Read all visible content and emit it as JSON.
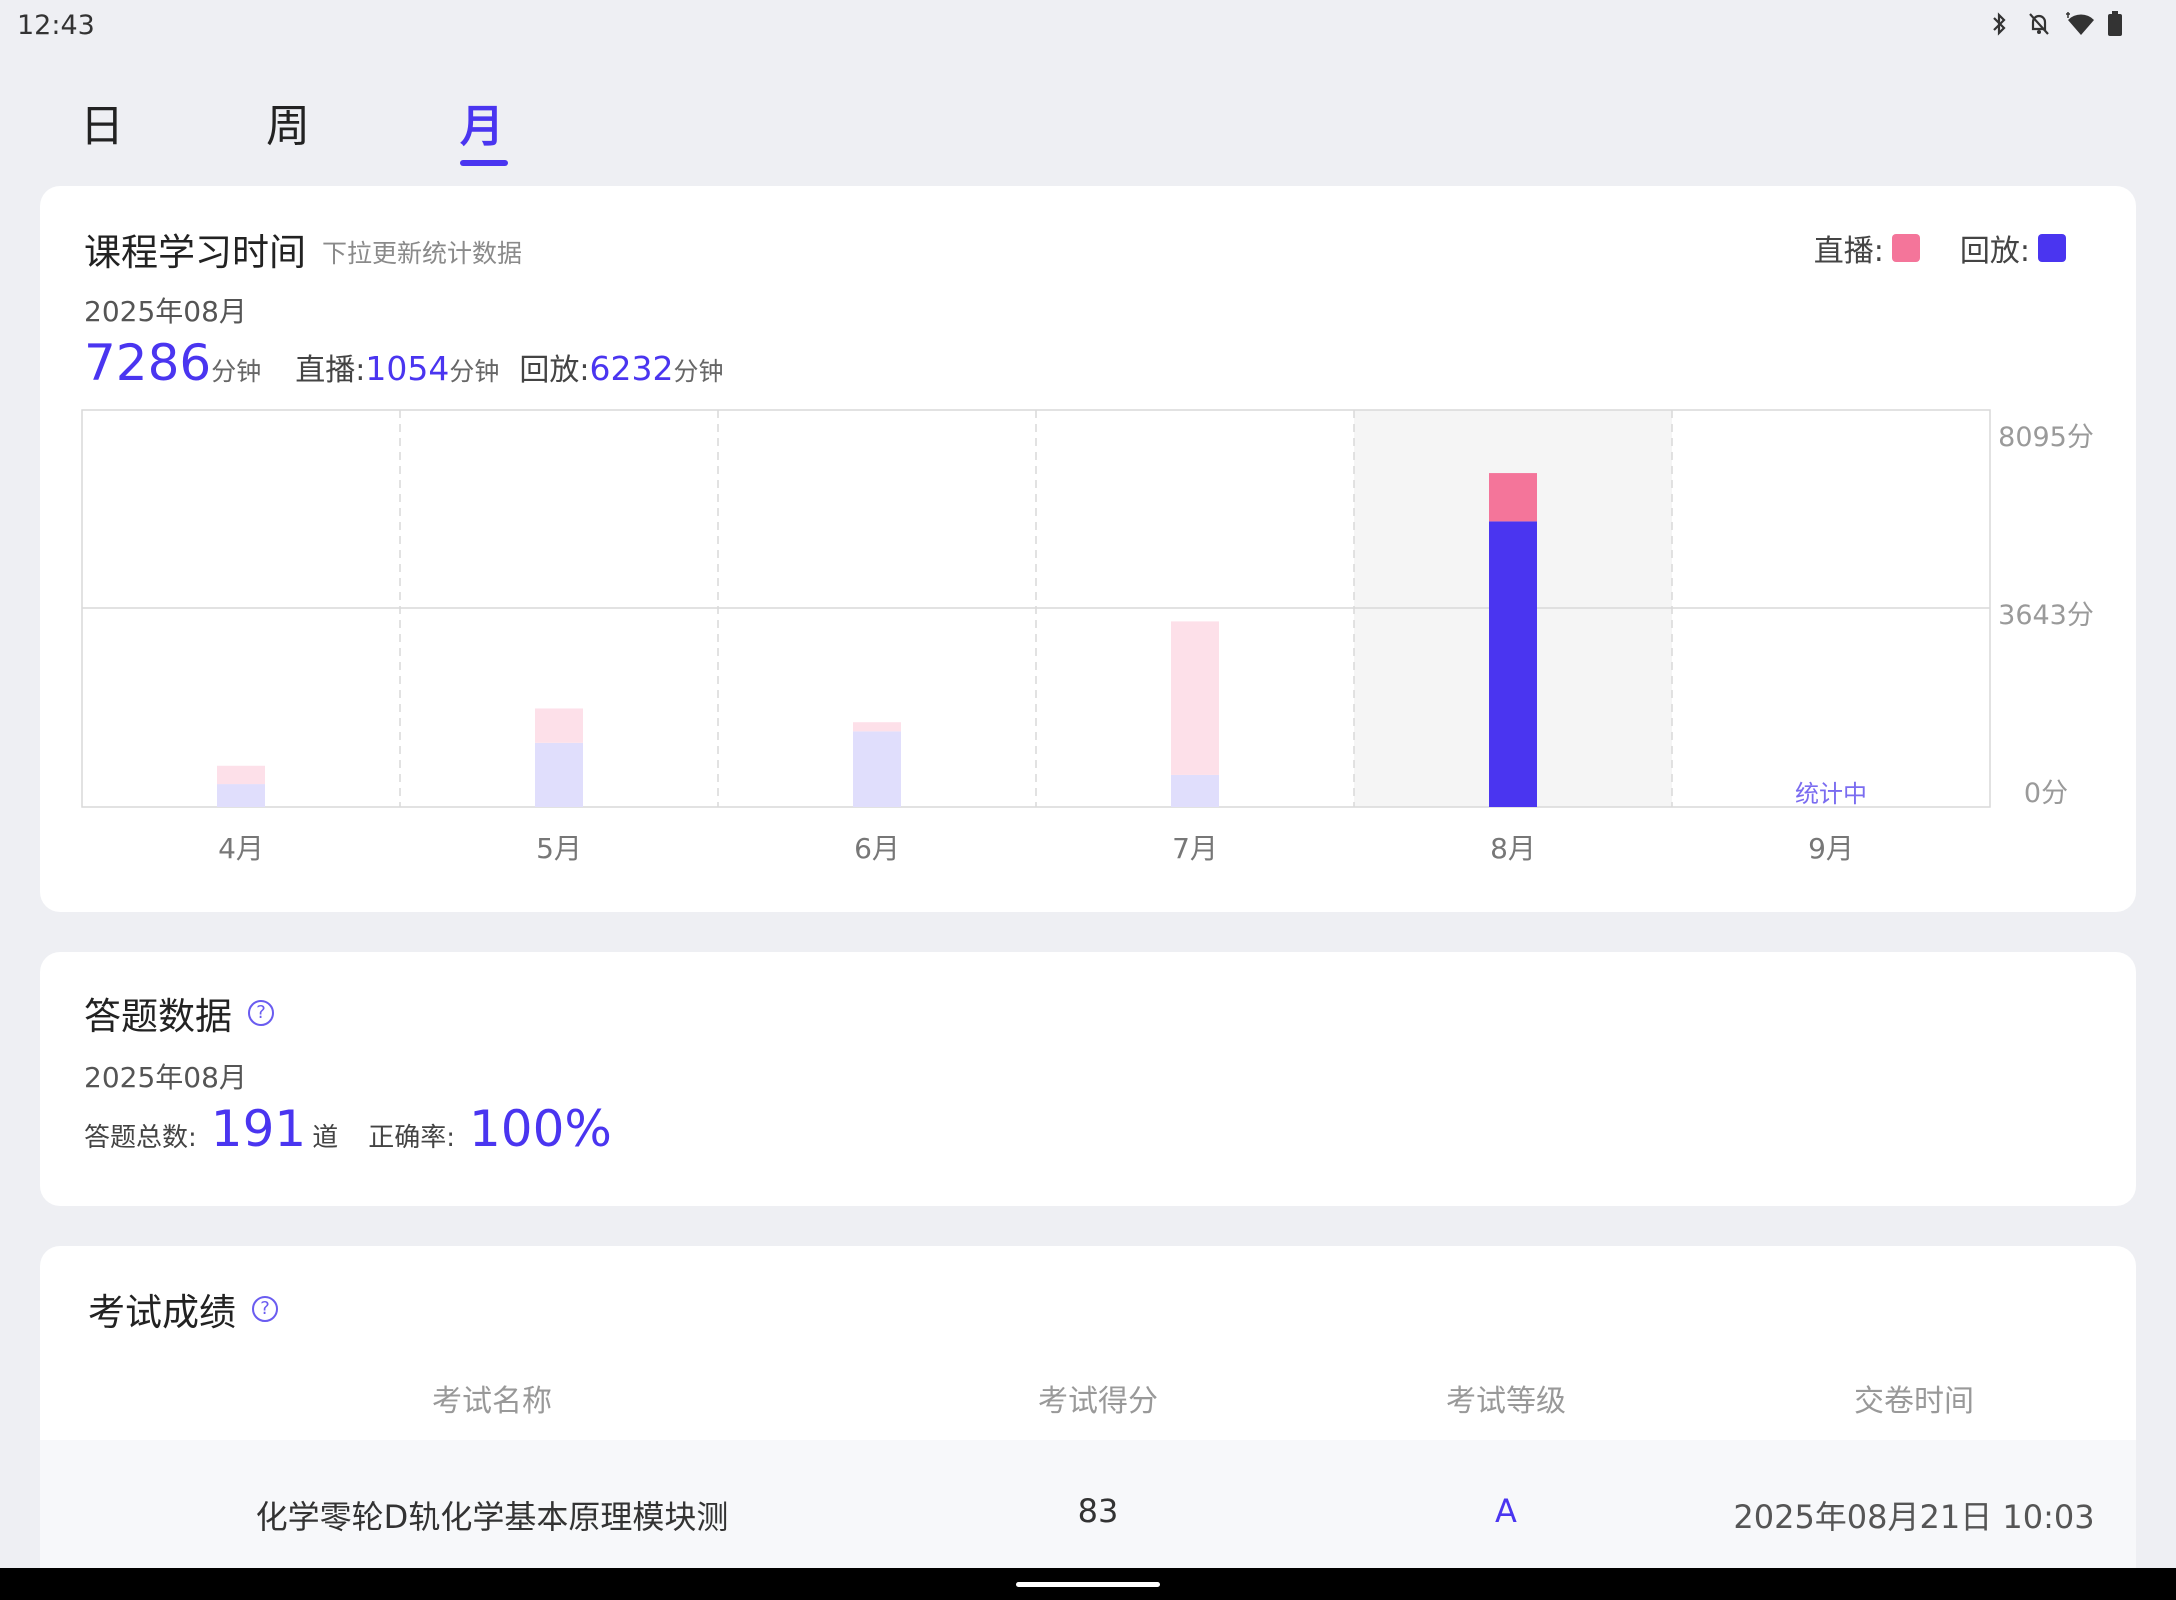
{
  "status_bar": {
    "time": "12:43",
    "icons": [
      "bluetooth-icon",
      "notifications-off-icon",
      "wifi-icon",
      "battery-icon"
    ]
  },
  "tabs": [
    {
      "label": "日",
      "active": false
    },
    {
      "label": "周",
      "active": false
    },
    {
      "label": "月",
      "active": true
    }
  ],
  "study_card": {
    "title": "课程学习时间",
    "subtitle": "下拉更新统计数据",
    "legend": [
      {
        "label": "直播:",
        "color": "#f4759a"
      },
      {
        "label": "回放:",
        "color": "#4a35f0"
      }
    ],
    "date": "2025年08月",
    "total_value": "7286",
    "total_unit": "分钟",
    "live_label": "直播:",
    "live_value": "1054",
    "live_unit": "分钟",
    "replay_label": "回放:",
    "replay_value": "6232",
    "replay_unit": "分钟"
  },
  "chart_data": {
    "type": "bar",
    "stacked": true,
    "categories": [
      "4月",
      "5月",
      "6月",
      "7月",
      "8月",
      "9月"
    ],
    "series": [
      {
        "name": "回放",
        "color": "#4a35f0",
        "faded_color": "#e0defc",
        "values": [
          500,
          1400,
          1650,
          700,
          6232,
          0
        ]
      },
      {
        "name": "直播",
        "color": "#f4759a",
        "faded_color": "#fde0e9",
        "values": [
          400,
          750,
          200,
          3350,
          1054,
          0
        ]
      }
    ],
    "y_ticks": [
      "8095分",
      "3643分",
      "0分"
    ],
    "ylim": [
      0,
      8095
    ],
    "highlight_index": 4,
    "pending_label": "统计中",
    "pending_index": 5
  },
  "answer_card": {
    "title": "答题数据",
    "help_icon": "help-circle-icon",
    "date": "2025年08月",
    "total_label": "答题总数:",
    "total_value": "191",
    "total_unit": "道",
    "accuracy_label": "正确率:",
    "accuracy_value": "100%"
  },
  "exam_card": {
    "title": "考试成绩",
    "help_icon": "help-circle-icon",
    "columns": [
      "考试名称",
      "考试得分",
      "考试等级",
      "交卷时间"
    ],
    "rows": [
      {
        "name": "化学零轮D轨化学基本原理模块测",
        "score": "83",
        "grade": "A",
        "time": "2025年08月21日 10:03"
      }
    ]
  }
}
